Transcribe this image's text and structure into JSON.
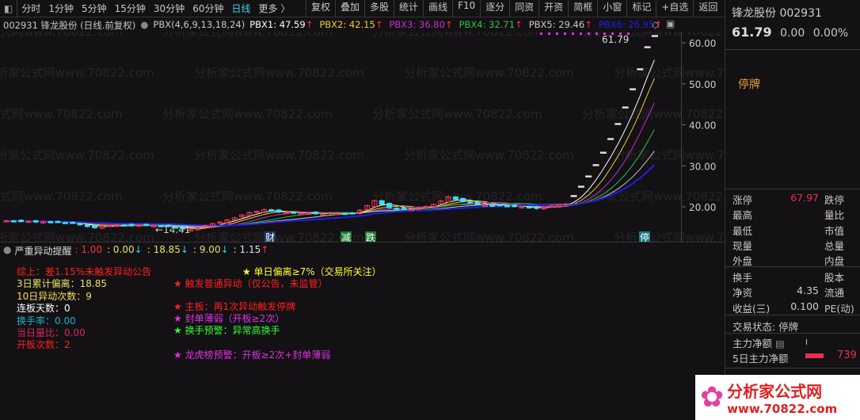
{
  "toolbar": {
    "periods": [
      "分时",
      "1分钟",
      "5分钟",
      "15分钟",
      "30分钟",
      "60分钟",
      "日线",
      "更多 〉"
    ],
    "active": "日线",
    "buttons": [
      "复权",
      "叠加",
      "多股",
      "统计",
      "画线",
      "F10",
      "逐分",
      "同资",
      "开资",
      "简框",
      "小窗",
      "标记",
      "+自选",
      "返回"
    ]
  },
  "info": {
    "title": "002931 锋龙股份 (日线.前复权)",
    "indicator": "PBX(4,6,9,13,18,24)",
    "pbx": [
      {
        "label": "PBX1: 47.59",
        "color": "#ffffff"
      },
      {
        "label": "PBX2: 42.15",
        "color": "#e8d030"
      },
      {
        "label": "PBX3: 36.80",
        "color": "#c030d0"
      },
      {
        "label": "PBX4: 32.71",
        "color": "#30c040"
      },
      {
        "label": "PBX5: 29.46",
        "color": "#c8c8c8"
      },
      {
        "label": "PBX6: 26.95",
        "color": "#2020e0"
      }
    ],
    "arrow": "↑"
  },
  "chart": {
    "y_ticks": [
      "60.00",
      "50.00",
      "40.00",
      "30.00",
      "20.00"
    ],
    "high_label": "61.79",
    "low_label": "←14.41",
    "markers": [
      {
        "text": "财",
        "bg": "#1a3a6a"
      },
      {
        "text": "减",
        "bg": "#1a7a2a"
      },
      {
        "text": "跌",
        "bg": "#1a7a2a"
      },
      {
        "text": "停",
        "bg": "#1a7a80"
      }
    ],
    "closes": [
      16.6,
      16.5,
      16.4,
      16.5,
      16.3,
      16.4,
      16.2,
      16.3,
      16.1,
      16.2,
      15.6,
      15.2,
      14.9,
      15.3,
      15.5,
      15.6,
      15.5,
      15.4,
      15.6,
      15.5,
      15.4,
      15.3,
      15.2,
      15.0,
      14.6,
      14.41,
      14.8,
      15.4,
      15.9,
      16.3,
      16.8,
      17.3,
      18.0,
      18.6,
      18.9,
      19.3,
      19.0,
      18.7,
      18.6,
      18.5,
      18.4,
      18.5,
      18.3,
      18.2,
      18.6,
      18.4,
      18.3,
      18.5,
      19.2,
      20.3,
      21.5,
      20.6,
      19.8,
      19.5,
      19.6,
      19.4,
      19.7,
      20.1,
      20.6,
      21.4,
      22.4,
      21.8,
      21.3,
      21.0,
      20.6,
      20.4,
      20.3,
      20.4,
      20.2,
      20.1,
      20.0,
      19.8,
      19.6,
      19.9,
      20.2,
      20.5,
      20.7,
      22.77,
      25.05,
      27.55,
      30.31,
      33.34,
      36.67,
      40.34,
      44.37,
      48.81,
      53.69,
      59.06,
      61.79
    ],
    "ma_periods": [
      4,
      6,
      9,
      13,
      18,
      24
    ],
    "watermark": "分析家公式网www.70822.com"
  },
  "panel": {
    "title": "严重异动提醒",
    "values": [
      {
        "text": ": 1.00",
        "color": "#ff3040",
        "arrow": ""
      },
      {
        "text": ": 0.00",
        "color": "#e8e060",
        "arrow": "↓"
      },
      {
        "text": ": 18.85",
        "color": "#e8e060",
        "arrow": "↓"
      },
      {
        "text": ": 9.00",
        "color": "#e8e060",
        "arrow": "↓"
      },
      {
        "text": ": 1.15",
        "color": "#e0e0e0",
        "arrow": "↑"
      }
    ],
    "left_lines": [
      {
        "text": "综上：差1.15%未触发异动公告",
        "color": "#ff2020"
      },
      {
        "text": "3日累计偏离：18.85",
        "color": "#e8e060"
      },
      {
        "text": "10日异动次数：9",
        "color": "#e8e060"
      },
      {
        "text": "连板天数：0",
        "color": "#ffffff"
      },
      {
        "text": "换手率：0.00",
        "color": "#20b0c0"
      },
      {
        "text": "当日量比：0.00",
        "color": "#e02060"
      },
      {
        "text": "开板次数：2",
        "color": "#ff2020"
      }
    ],
    "right_lines": [
      {
        "text": "★ 单日偏离≥7%（交易所关注）",
        "color": "#ffff30"
      },
      {
        "text": "★ 触发普通异动（仅公告，未监管）",
        "color": "#ff2020"
      },
      {
        "text": "★ 主板：再1次异动触发停牌",
        "color": "#ff2020"
      },
      {
        "text": "★ 封单薄弱（开板≥2次）",
        "color": "#e030e0"
      },
      {
        "text": "★ 换手预警：异常高换手",
        "color": "#30ff30"
      },
      {
        "text": "★ 龙虎榜预警：开板≥2次+封单薄弱",
        "color": "#e030e0"
      }
    ]
  },
  "right": {
    "name": "锋龙股份 002931",
    "price": "61.79",
    "change": "0.00",
    "pct": "0.00%",
    "status_big": "停牌",
    "rows1": [
      [
        "涨停",
        "67.97",
        "跌停"
      ],
      [
        "最高",
        "",
        "量比"
      ],
      [
        "最低",
        "",
        "市值"
      ],
      [
        "现量",
        "",
        "总量"
      ],
      [
        "外盘",
        "",
        "内盘"
      ]
    ],
    "rows2": [
      [
        "换手",
        "",
        "股本"
      ],
      [
        "净资",
        "4.35",
        "流通"
      ],
      [
        "收益(三)",
        "0.100",
        "PE(动)"
      ]
    ],
    "trade_status": "交易状态: 停牌",
    "main_net": "主力净额",
    "main_net5": "5日主力净额",
    "main_net5_value": "739"
  },
  "logo": {
    "text": "分析家公式网",
    "url": "www.70822.com"
  }
}
